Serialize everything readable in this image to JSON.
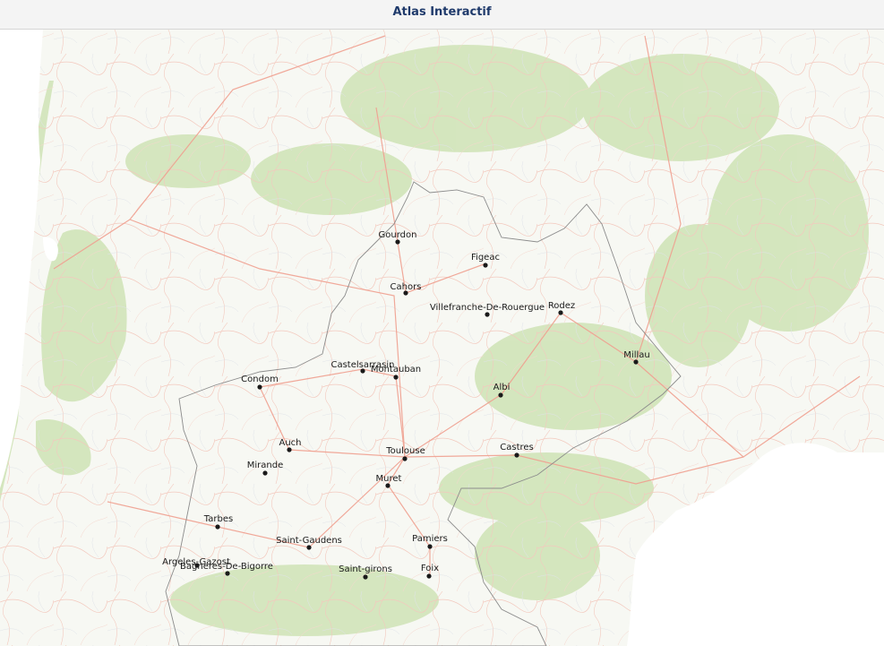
{
  "app": {
    "title": "Atlas Interactif"
  },
  "map": {
    "colors": {
      "land": "#f7f8f3",
      "forest": "#cfe3b5",
      "water": "#ffffff",
      "roads": "#f0a090",
      "minor_roads": "#f3c8bd",
      "boundary": "#8c8c8c"
    },
    "cities": [
      {
        "id": "gourdon",
        "name": "Gourdon"
      },
      {
        "id": "figeac",
        "name": "Figeac"
      },
      {
        "id": "cahors",
        "name": "Cahors"
      },
      {
        "id": "villefranche",
        "name": "Villefranche-De-Rouergue"
      },
      {
        "id": "rodez",
        "name": "Rodez"
      },
      {
        "id": "millau",
        "name": "Millau"
      },
      {
        "id": "castelsarrasin",
        "name": "Castelsarrasin"
      },
      {
        "id": "montauban",
        "name": "Montauban"
      },
      {
        "id": "condom",
        "name": "Condom"
      },
      {
        "id": "albi",
        "name": "Albi"
      },
      {
        "id": "auch",
        "name": "Auch"
      },
      {
        "id": "toulouse",
        "name": "Toulouse"
      },
      {
        "id": "castres",
        "name": "Castres"
      },
      {
        "id": "mirande",
        "name": "Mirande"
      },
      {
        "id": "muret",
        "name": "Muret"
      },
      {
        "id": "tarbes",
        "name": "Tarbes"
      },
      {
        "id": "saint-gaudens",
        "name": "Saint-Gaudens"
      },
      {
        "id": "pamiers",
        "name": "Pamiers"
      },
      {
        "id": "argeles",
        "name": "Argeles-Gazost"
      },
      {
        "id": "bagneres",
        "name": "Bagneres-De-Bigorre"
      },
      {
        "id": "saint-girons",
        "name": "Saint-girons"
      },
      {
        "id": "foix",
        "name": "Foix"
      }
    ]
  }
}
